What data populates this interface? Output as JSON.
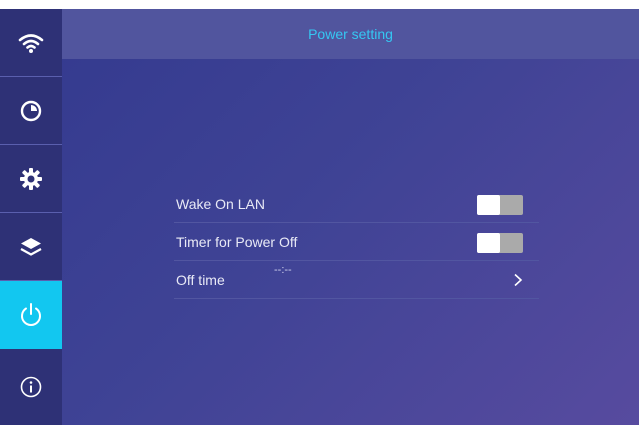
{
  "header": {
    "title": "Power setting"
  },
  "sidebar": {
    "items": [
      {
        "id": "wifi",
        "icon": "wifi-icon",
        "active": false
      },
      {
        "id": "timer",
        "icon": "clock-icon",
        "active": false
      },
      {
        "id": "settings",
        "icon": "gear-icon",
        "active": false
      },
      {
        "id": "layers",
        "icon": "layers-icon",
        "active": false
      },
      {
        "id": "power",
        "icon": "power-icon",
        "active": true
      },
      {
        "id": "info",
        "icon": "info-icon",
        "active": false
      }
    ]
  },
  "settings": {
    "wake_on_lan": {
      "label": "Wake On LAN",
      "enabled": false
    },
    "timer_power_off": {
      "label": "Timer for Power Off",
      "enabled": false
    },
    "off_time": {
      "label": "Off time",
      "value": "--:--"
    }
  },
  "colors": {
    "accent": "#12c7f0",
    "header_text": "#35c7f2",
    "sidebar_bg": "#2e3176",
    "main_bg": "#3b3f8e"
  }
}
